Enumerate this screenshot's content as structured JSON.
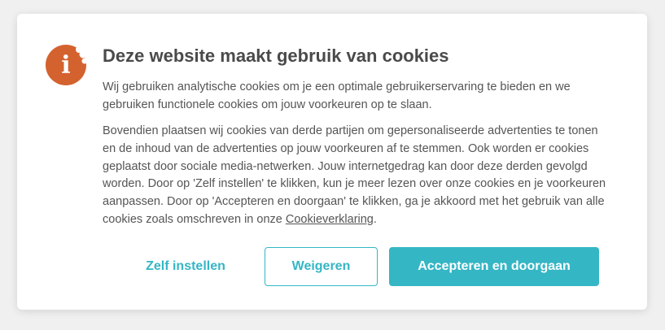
{
  "dialog": {
    "title": "Deze website maakt gebruik van cookies",
    "paragraph1": "Wij gebruiken analytische cookies om je een optimale gebruikerservaring te bieden en we gebruiken functionele cookies om jouw voorkeuren op te slaan.",
    "paragraph2_text": "Bovendien plaatsen wij cookies van derde partijen om gepersonaliseerde advertenties te tonen en de inhoud van de advertenties op jouw voorkeuren af te stemmen. Ook worden er cookies geplaatst door sociale media-netwerken. Jouw internetgedrag kan door deze derden gevolgd worden. Door op 'Zelf instellen' te klikken, kun je meer lezen over onze cookies en je voorkeuren aanpassen. Door op 'Accepteren en doorgaan' te klikken, ga je akkoord met het gebruik van alle cookies zoals omschreven in onze ",
    "paragraph2_link": "Cookieverklaring",
    "paragraph2_end": ".",
    "logo_icon": "info-cookie-icon",
    "logo_glyph": "i"
  },
  "buttons": {
    "settings_label": "Zelf instellen",
    "refuse_label": "Weigeren",
    "accept_label": "Accepteren en doorgaan"
  },
  "colors": {
    "accent": "#35b6c5",
    "logo": "#d4622f",
    "title": "#4a4a4a",
    "text": "#555555"
  }
}
